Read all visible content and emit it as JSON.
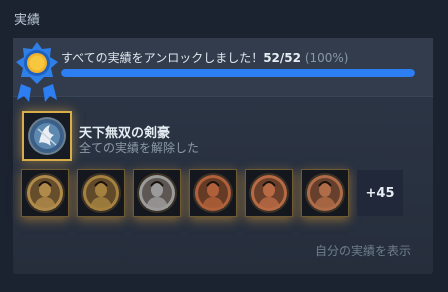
{
  "section": {
    "title": "実績"
  },
  "summary": {
    "text": "すべての実績をアンロックしました！",
    "count": "52/52",
    "percent": "(100%)",
    "progress": 1.0
  },
  "featured": {
    "name": "天下無双の剣豪",
    "description": "全ての実績を解除した",
    "icon": "samurai-crest-icon"
  },
  "achievements": [
    {
      "icon": "warrior-portrait-icon",
      "tone": "#b08a4a"
    },
    {
      "icon": "warrior-portrait-icon",
      "tone": "#a58140"
    },
    {
      "icon": "woman-portrait-icon",
      "tone": "#9b9b9b"
    },
    {
      "icon": "kanji-emblem-icon",
      "tone": "#b0603a"
    },
    {
      "icon": "demon-portrait-icon",
      "tone": "#b86a44"
    },
    {
      "icon": "woman-portrait-icon",
      "tone": "#b06c48"
    }
  ],
  "more": {
    "label": "+45"
  },
  "view_link": {
    "label": "自分の実績を表示"
  },
  "colors": {
    "accent": "#2c7ef2",
    "gold": "#d9ad4a",
    "panel": "#2d3646"
  }
}
